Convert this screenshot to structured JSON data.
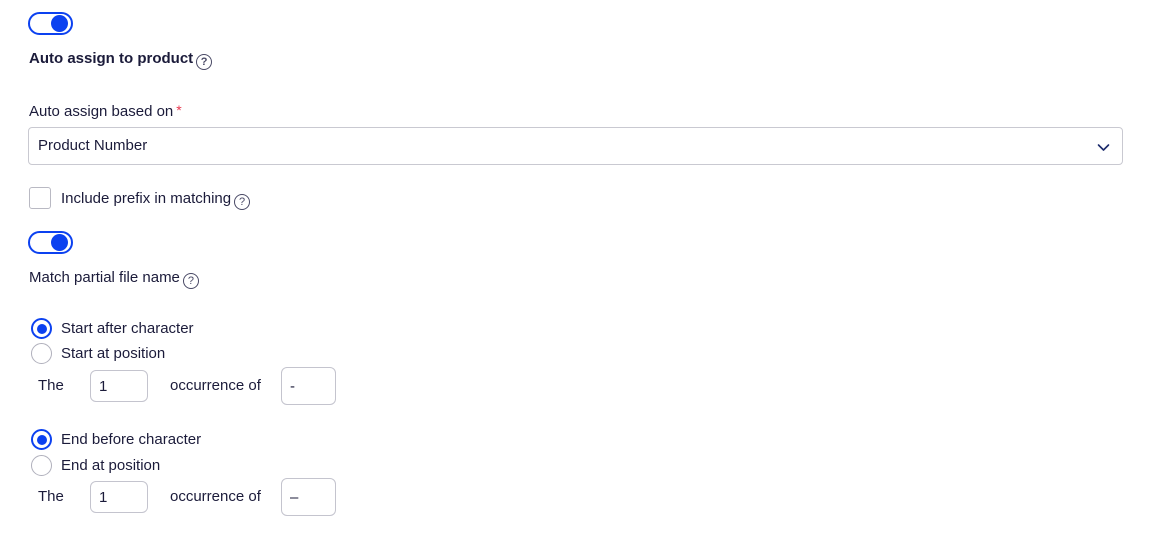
{
  "form": {
    "auto_assign_toggle": {
      "label": "Auto assign to product",
      "state": "on",
      "help": "?"
    },
    "auto_assign_based_on": {
      "label": "Auto assign based on",
      "required_marker": "*",
      "value": "Product Number",
      "chevron": "chevron-down"
    },
    "include_prefix": {
      "label": "Include prefix in matching",
      "checked": false,
      "help": "?"
    },
    "match_partial_toggle": {
      "label": "Match partial file name",
      "state": "on",
      "help": "?"
    },
    "start_group": {
      "option_character": "Start after character",
      "option_position": "Start at position",
      "selected": "character",
      "prefix_text": "The",
      "occurrence_value": "1",
      "middle_text": "occurrence of",
      "character_value": "-"
    },
    "end_group": {
      "option_character": "End before character",
      "option_position": "End at position",
      "selected": "character",
      "prefix_text": "The",
      "occurrence_value": "1",
      "middle_text": "occurrence of",
      "character_value": "–"
    }
  },
  "colors": {
    "accent": "#0c41f0",
    "text": "#1b1b3a",
    "required": "#e8384f",
    "border": "#c9c9d1"
  }
}
